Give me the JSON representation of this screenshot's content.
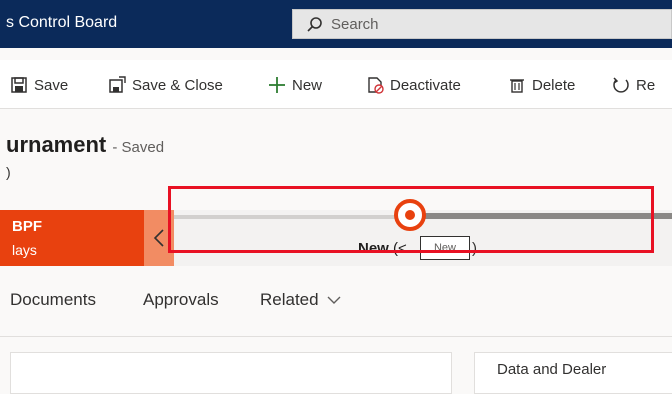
{
  "topbar": {
    "app_title": "s Control Board",
    "search_placeholder": "Search"
  },
  "commands": {
    "save": "Save",
    "save_close": "Save & Close",
    "new": "New",
    "deactivate": "Deactivate",
    "delete": "Delete",
    "refresh": "Re"
  },
  "header": {
    "title": "urnament",
    "status": "- Saved",
    "subtext": ")"
  },
  "bpf": {
    "stage_name": "BPF",
    "stage_days": "lays",
    "active_stage_label": "New",
    "paren_left": "(<",
    "tooltip": "New",
    "paren_right": ")"
  },
  "tabs": {
    "documents": "Documents",
    "approvals": "Approvals",
    "related": "Related"
  },
  "card2_title": "Data and Dealer"
}
